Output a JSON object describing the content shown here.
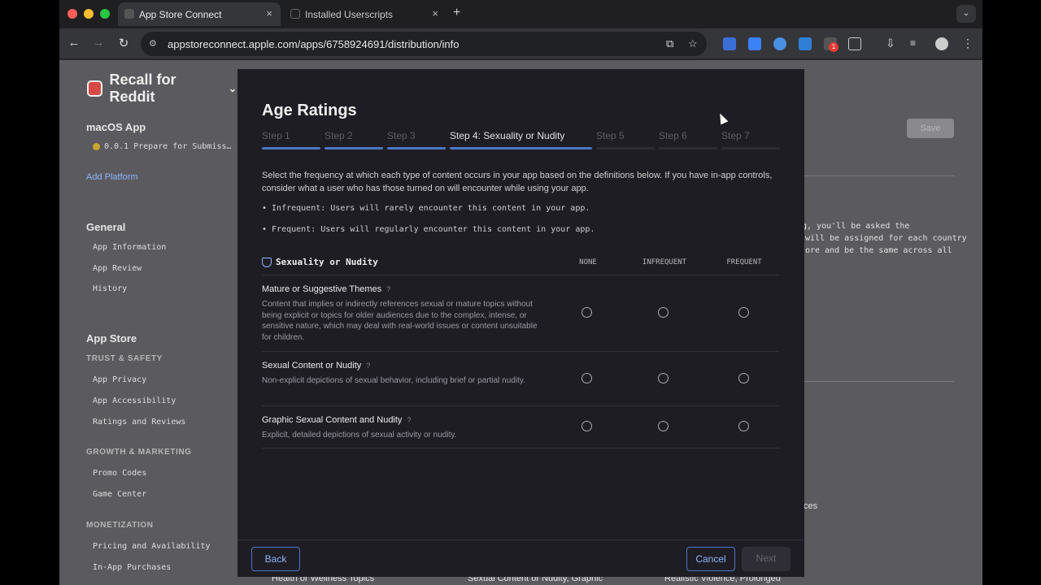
{
  "browser": {
    "tabs": [
      {
        "title": "App Store Connect",
        "close": "×"
      },
      {
        "title": "Installed Userscripts",
        "close": "×"
      }
    ],
    "new_tab": "+",
    "tab_menu": "⌄",
    "url": "appstoreconnect.apple.com/apps/6758924691/distribution/info",
    "nav": {
      "back": "←",
      "forward": "→",
      "reload": "↻"
    },
    "ext_badge": "1"
  },
  "sidebar": {
    "app_name": "Recall for Reddit",
    "platform": "macOS App",
    "version": "0.0.1 Prepare for Submiss…",
    "add_platform": "Add Platform",
    "general_header": "General",
    "general_items": [
      "App Information",
      "App Review",
      "History"
    ],
    "appstore_header": "App Store",
    "trust_header": "TRUST & SAFETY",
    "trust_items": [
      "App Privacy",
      "App Accessibility",
      "Ratings and Reviews"
    ],
    "growth_header": "GROWTH & MARKETING",
    "growth_items": [
      "Promo Codes",
      "Game Center"
    ],
    "monet_header": "MONETIZATION",
    "monet_items": [
      "Pricing and Availability",
      "In-App Purchases"
    ]
  },
  "background": {
    "save": "Save",
    "text_lines": [
      "g, you'll be asked the",
      "will be assigned for each country",
      "ore and be the same across all"
    ],
    "ces": "ces",
    "bottom_categories": [
      "Health or Wellness Topics",
      "Sexual Content or Nudity, Graphic",
      "Realistic Violence, Prolonged"
    ]
  },
  "modal": {
    "title": "Age Ratings",
    "steps": [
      "Step 1",
      "Step 2",
      "Step 3",
      "Step 4: Sexuality or Nudity",
      "Step 5",
      "Step 6",
      "Step 7"
    ],
    "intro": "Select the frequency at which each type of content occurs in your app based on the definitions below. If you have in-app controls, consider what a user who has those turned on will encounter while using your app.",
    "bullets": [
      "• Infrequent: Users will rarely encounter this content in your app.",
      "• Frequent: Users will regularly encounter this content in your app."
    ],
    "section": "Sexuality or Nudity",
    "columns": [
      "NONE",
      "INFREQUENT",
      "FREQUENT"
    ],
    "questions": [
      {
        "title": "Mature or Suggestive Themes",
        "desc": "Content that implies or indirectly references sexual or mature topics without being explicit or topics for older audiences due to the complex, intense, or sensitive nature, which may deal with real-world issues or content unsuitable for children."
      },
      {
        "title": "Sexual Content or Nudity",
        "desc": "Non-explicit depictions of sexual behavior, including brief or partial nudity."
      },
      {
        "title": "Graphic Sexual Content and Nudity",
        "desc": "Explicit, detailed depictions of sexual activity or nudity."
      }
    ],
    "help": "?",
    "back": "Back",
    "cancel": "Cancel",
    "next": "Next"
  }
}
